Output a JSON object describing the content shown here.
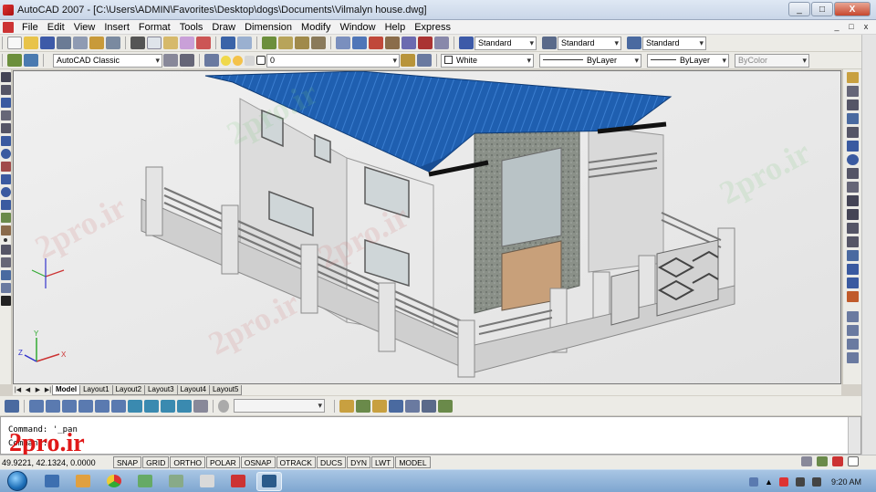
{
  "window": {
    "title": "AutoCAD 2007 - [C:\\Users\\ADMIN\\Favorites\\Desktop\\dogs\\Documents\\Vilmalyn house.dwg]",
    "controls": [
      "_",
      "□",
      "X"
    ]
  },
  "menu": {
    "items": [
      "File",
      "Edit",
      "View",
      "Insert",
      "Format",
      "Tools",
      "Draw",
      "Dimension",
      "Modify",
      "Window",
      "Help",
      "Express"
    ],
    "mdi_controls": [
      "_",
      "□",
      "x"
    ]
  },
  "toolbar1": {
    "text_style": "Standard",
    "dim_style": "Standard",
    "table_style": "Standard"
  },
  "toolbar2": {
    "workspace": "AutoCAD Classic",
    "layer": "0",
    "color": "White",
    "linetype": "ByLayer",
    "lineweight": "ByLayer",
    "plotstyle": "ByColor"
  },
  "layout_tabs": {
    "nav": [
      "|◀",
      "◀",
      "▶",
      "▶|"
    ],
    "tabs": [
      "Model",
      "Layout1",
      "Layout2",
      "Layout3",
      "Layout4",
      "Layout5"
    ],
    "active": "Model"
  },
  "command_line": {
    "lines": [
      "Command: '_pan",
      "Command:"
    ]
  },
  "status_bar": {
    "coordinates": "49.9221, 42.1324, 0.0000",
    "buttons": [
      "SNAP",
      "GRID",
      "ORTHO",
      "POLAR",
      "OSNAP",
      "OTRACK",
      "DUCS",
      "DYN",
      "LWT",
      "MODEL"
    ]
  },
  "taskbar": {
    "time": "9:20 AM"
  },
  "watermark": {
    "text": "2pro.ir",
    "logo": "2pro.ir"
  },
  "colors": {
    "roof_blue": "#1f5fb0",
    "stone_gray": "#8a9088",
    "title_bar": "#c9d6e8",
    "watermark_red": "#e01818"
  }
}
